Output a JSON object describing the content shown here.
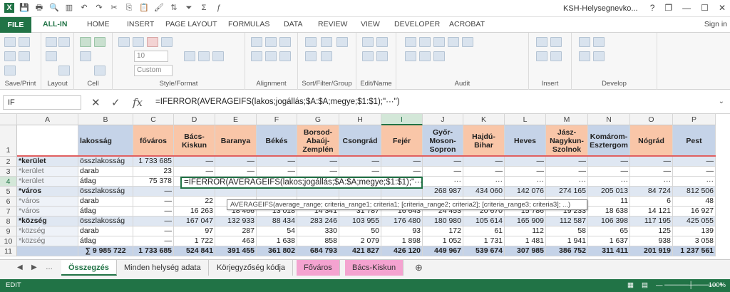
{
  "window": {
    "title": "KSH-Helysegnevko...",
    "help": "?",
    "restore": "❐",
    "minimize": "—",
    "maximize": "☐",
    "close": "✕"
  },
  "tabs": [
    "FILE",
    "ALL-IN",
    "HOME",
    "INSERT",
    "PAGE LAYOUT",
    "FORMULAS",
    "DATA",
    "REVIEW",
    "VIEW",
    "DEVELOPER",
    "ACROBAT"
  ],
  "signin": "Sign in",
  "ribbon": {
    "groups": [
      "Save/Print",
      "Layout",
      "Cell",
      "Style/Format",
      "Alignment",
      "Sort/Filter/Group",
      "Edit/Name",
      "Audit",
      "Insert",
      "Develop"
    ],
    "font_size": "10",
    "number_format": "Custom"
  },
  "formula_bar": {
    "name_box": "IF",
    "fx": "fx",
    "cancel": "✕",
    "enter": "✓",
    "formula": "=IFERROR(AVERAGEIFS(lakos;jogállás;$A:$A;megye;$1:$1);\"···\")"
  },
  "columns": [
    "A",
    "B",
    "C",
    "D",
    "E",
    "F",
    "G",
    "H",
    "I",
    "J",
    "K",
    "L",
    "M",
    "N",
    "O",
    "P"
  ],
  "header_row": [
    "",
    "lakosság",
    "főváros",
    "Bács-Kiskun",
    "Baranya",
    "Békés",
    "Borsod-Abaúj-Zemplén",
    "Csongrád",
    "Fejér",
    "Győr-Moson-Sopron",
    "Hajdú-Bihar",
    "Heves",
    "Jász-Nagykun-Szolnok",
    "Komárom-Esztergom",
    "Nógrád",
    "Pest"
  ],
  "rows": [
    {
      "n": "2",
      "a": "*kerület",
      "b": "összlakosság",
      "c": "1 733 685",
      "vals": [
        "—",
        "—",
        "—",
        "—",
        "—",
        "—",
        "—",
        "—",
        "—",
        "—",
        "—",
        "—",
        "—"
      ]
    },
    {
      "n": "3",
      "a": "*kerület",
      "b": "darab",
      "c": "23",
      "vals": [
        "—",
        "—",
        "—",
        "—",
        "—",
        "—",
        "—",
        "—",
        "—",
        "—",
        "—",
        "—",
        "—"
      ]
    },
    {
      "n": "4",
      "a": "*kerület",
      "b": "átlag",
      "c": "75 378",
      "vals": [
        "",
        "",
        "",
        "",
        "",
        "",
        "···",
        "···",
        "···",
        "···",
        "···",
        "···",
        "···"
      ]
    },
    {
      "n": "5",
      "a": "*város",
      "b": "összlakosság",
      "c": "—",
      "vals": [
        "",
        "",
        "",
        "",
        "",
        "",
        "268 987",
        "434 060",
        "142 076",
        "274 165",
        "205 013",
        "84 724",
        "812 506"
      ]
    },
    {
      "n": "6",
      "a": "*város",
      "b": "darab",
      "c": "—",
      "vals": [
        "22",
        "",
        "",
        "",
        "",
        "",
        "",
        "",
        "",
        "",
        "11",
        "6",
        "48"
      ]
    },
    {
      "n": "7",
      "a": "*város",
      "b": "átlag",
      "c": "—",
      "vals": [
        "16 263",
        "18 466",
        "13 018",
        "14 341",
        "31 787",
        "16 643",
        "24 453",
        "20 670",
        "15 786",
        "19 233",
        "18 638",
        "14 121",
        "16 927"
      ]
    },
    {
      "n": "8",
      "a": "*község",
      "b": "összlakosság",
      "c": "—",
      "vals": [
        "167 047",
        "132 933",
        "88 434",
        "283 246",
        "103 955",
        "176 480",
        "180 980",
        "105 614",
        "165 909",
        "112 587",
        "106 398",
        "117 195",
        "425 055"
      ]
    },
    {
      "n": "9",
      "a": "*község",
      "b": "darab",
      "c": "—",
      "vals": [
        "97",
        "287",
        "54",
        "330",
        "50",
        "93",
        "172",
        "61",
        "112",
        "58",
        "65",
        "125",
        "139"
      ]
    },
    {
      "n": "10",
      "a": "*község",
      "b": "átlag",
      "c": "—",
      "vals": [
        "1 722",
        "463",
        "1 638",
        "858",
        "2 079",
        "1 898",
        "1 052",
        "1 731",
        "1 481",
        "1 941",
        "1 637",
        "938",
        "3 058"
      ]
    },
    {
      "n": "11",
      "a": "",
      "b": "∑ 9 985 722",
      "c": "1 733 685",
      "vals": [
        "524 841",
        "391 455",
        "361 802",
        "684 793",
        "421 827",
        "426 120",
        "449 967",
        "539 674",
        "307 985",
        "386 752",
        "311 411",
        "201 919",
        "1 237 561"
      ]
    }
  ],
  "edit_cell_text": "=IFERROR(AVERAGEIFS(lakos;jogállás;$A:$A;megye;$1:$1);\"···\")",
  "tooltip": "AVERAGEIFS(average_range; criteria_range1; criteria1; [criteria_range2; criteria2]; [criteria_range3; criteria3]; ...)",
  "sheets": [
    "Összegzés",
    "Minden helység adata",
    "Körjegyzőség kódja",
    "Főváros",
    "Bács-Kiskun"
  ],
  "status": {
    "mode": "EDIT",
    "zoom": "100%"
  }
}
